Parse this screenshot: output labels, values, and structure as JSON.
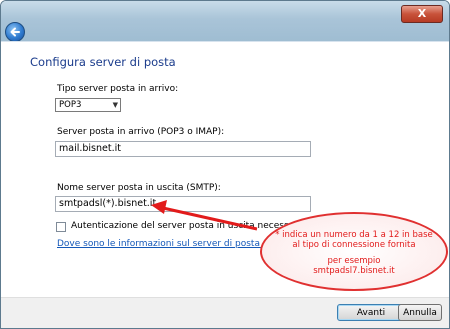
{
  "window": {
    "close_label": "X"
  },
  "wizard": {
    "heading": "Configura server di posta",
    "incoming_type_label": "Tipo server posta in arrivo:",
    "incoming_type_value": "POP3",
    "incoming_server_label": "Server posta in arrivo (POP3 o IMAP):",
    "incoming_server_value": "mail.bisnet.it",
    "outgoing_server_label": "Nome server posta in uscita (SMTP):",
    "outgoing_server_value": "smtpadsl(*).bisnet.it",
    "auth_checkbox_label": "Autenticazione del server posta in uscita necessaria",
    "auth_checked": false,
    "help_link": "Dove sono le informazioni sul server di posta elettronica?"
  },
  "footer": {
    "next_label": "Avanti",
    "cancel_label": "Annulla"
  },
  "annotation": {
    "line1": "* indica un numero da 1 a 12 in base",
    "line2": "al tipo di connessione fornita",
    "line3": "per esempio",
    "line4": "smtpadsl7.bisnet.it",
    "color": "#e21b1b"
  },
  "icons": {
    "back": "back-arrow-icon",
    "dropdown": "chevron-down-icon",
    "annotation_arrow": "arrow-icon"
  }
}
